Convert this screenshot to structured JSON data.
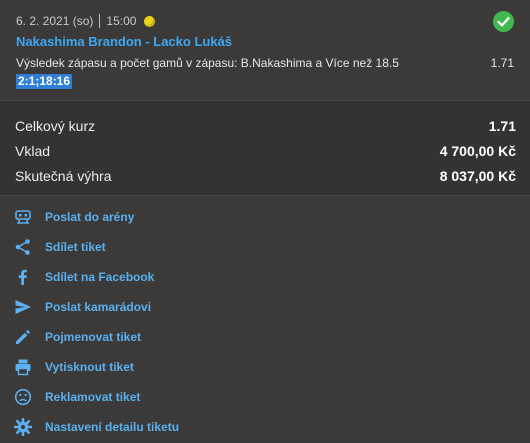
{
  "ticket": {
    "date": "6. 2. 2021 (so)",
    "time": "15:00",
    "match": "Nakashima Brandon - Lacko Lukáš",
    "bet_label": "Výsledek zápasu a počet gamů v zápasu: B.Nakashima a Více než 18.5",
    "bet_odd": "1.71",
    "score": "2:1;18:16",
    "status_color": "#3fb950"
  },
  "summary": [
    {
      "label": "Celkový kurz",
      "value": "1.71"
    },
    {
      "label": "Vklad",
      "value": "4 700,00 Kč"
    },
    {
      "label": "Skutečná výhra",
      "value": "8 037,00 Kč"
    }
  ],
  "actions": [
    {
      "icon": "arena-icon",
      "label": "Poslat do arény"
    },
    {
      "icon": "share-icon",
      "label": "Sdílet tiket"
    },
    {
      "icon": "facebook-icon",
      "label": "Sdílet na Facebook"
    },
    {
      "icon": "send-icon",
      "label": "Poslat kamarádovi"
    },
    {
      "icon": "pencil-icon",
      "label": "Pojmenovat tiket"
    },
    {
      "icon": "print-icon",
      "label": "Vytisknout tiket"
    },
    {
      "icon": "sad-face-icon",
      "label": "Reklamovat tiket"
    },
    {
      "icon": "gear-icon",
      "label": "Nastavení detailu tiketu"
    }
  ],
  "colors": {
    "accent": "#5ab0f0",
    "link": "#3da8f2",
    "badge": "#2f7fd6"
  }
}
